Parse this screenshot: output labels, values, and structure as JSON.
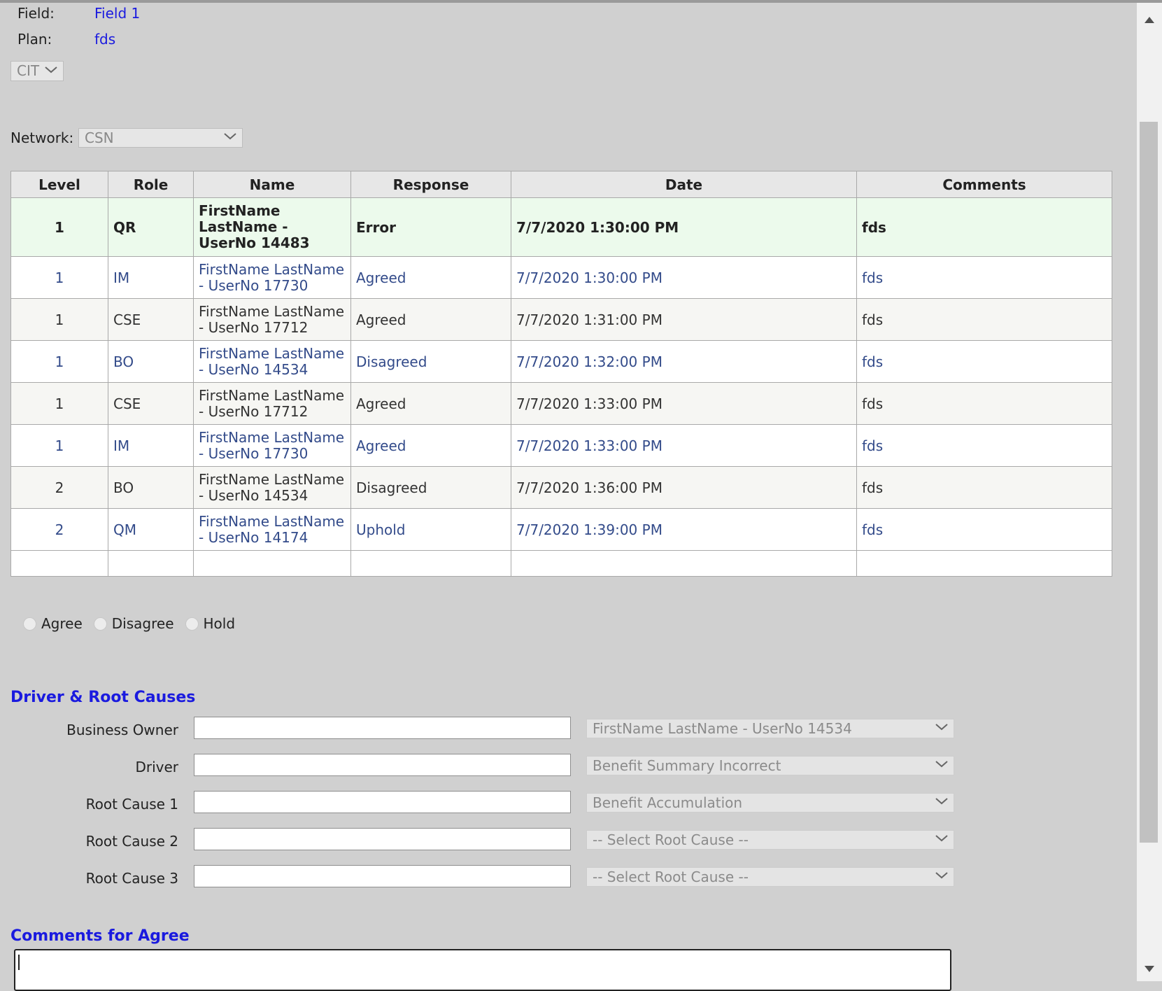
{
  "header": {
    "field_label": "Field:",
    "field_value": "Field 1",
    "plan_label": "Plan:",
    "plan_value": "fds",
    "cit_select": "CIT"
  },
  "network": {
    "label": "Network:",
    "value": "CSN"
  },
  "table": {
    "columns": [
      "Level",
      "Role",
      "Name",
      "Response",
      "Date",
      "Comments"
    ],
    "rows": [
      {
        "level": "1",
        "role": "QR",
        "name": "FirstName LastName - UserNo 14483",
        "response": "Error",
        "date": "7/7/2020 1:30:00 PM",
        "comments": "fds"
      },
      {
        "level": "1",
        "role": "IM",
        "name": "FirstName LastName - UserNo 17730",
        "response": "Agreed",
        "date": "7/7/2020 1:30:00 PM",
        "comments": "fds"
      },
      {
        "level": "1",
        "role": "CSE",
        "name": "FirstName LastName - UserNo 17712",
        "response": "Agreed",
        "date": "7/7/2020 1:31:00 PM",
        "comments": "fds"
      },
      {
        "level": "1",
        "role": "BO",
        "name": "FirstName LastName - UserNo 14534",
        "response": "Disagreed",
        "date": "7/7/2020 1:32:00 PM",
        "comments": "fds"
      },
      {
        "level": "1",
        "role": "CSE",
        "name": "FirstName LastName - UserNo 17712",
        "response": "Agreed",
        "date": "7/7/2020 1:33:00 PM",
        "comments": "fds"
      },
      {
        "level": "1",
        "role": "IM",
        "name": "FirstName LastName - UserNo 17730",
        "response": "Agreed",
        "date": "7/7/2020 1:33:00 PM",
        "comments": "fds"
      },
      {
        "level": "2",
        "role": "BO",
        "name": "FirstName LastName - UserNo 14534",
        "response": "Disagreed",
        "date": "7/7/2020 1:36:00 PM",
        "comments": "fds"
      },
      {
        "level": "2",
        "role": "QM",
        "name": "FirstName LastName - UserNo 14174",
        "response": "Uphold",
        "date": "7/7/2020 1:39:00 PM",
        "comments": "fds"
      }
    ]
  },
  "response_options": [
    "Agree",
    "Disagree",
    "Hold"
  ],
  "driver_section": {
    "title": "Driver & Root Causes",
    "fields": [
      {
        "label": "Business Owner",
        "text": "",
        "select": "FirstName LastName - UserNo 14534"
      },
      {
        "label": "Driver",
        "text": "",
        "select": "Benefit Summary Incorrect"
      },
      {
        "label": "Root Cause 1",
        "text": "",
        "select": "Benefit Accumulation"
      },
      {
        "label": "Root Cause 2",
        "text": "",
        "select": "-- Select Root Cause --"
      },
      {
        "label": "Root Cause 3",
        "text": "",
        "select": "-- Select Root Cause --"
      }
    ]
  },
  "comments_section": {
    "title": "Comments for Agree",
    "value": ""
  },
  "icons": {
    "dropdown": "chevron-down-icon",
    "scroll_up": "scroll-up-arrow-icon",
    "scroll_down": "scroll-down-arrow-icon"
  }
}
